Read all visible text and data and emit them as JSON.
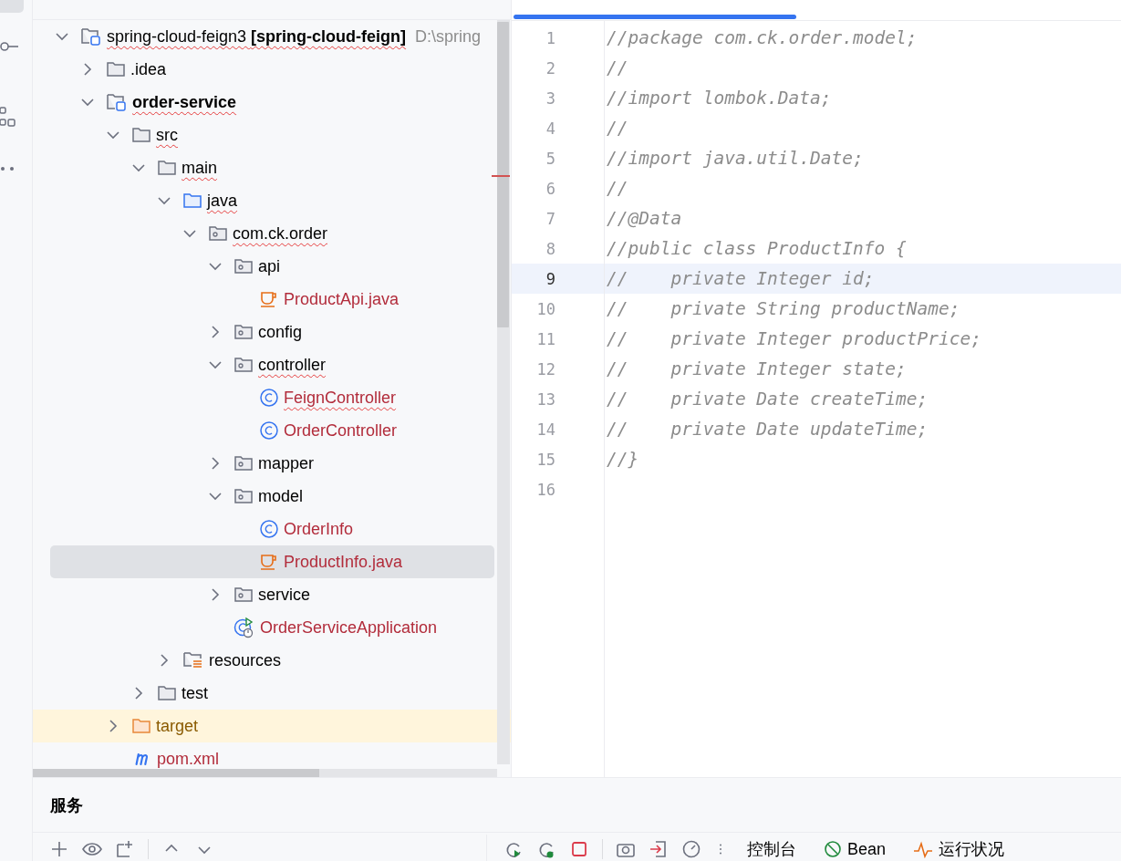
{
  "project_tree": {
    "items": [
      {
        "label": "spring-cloud-feign3 **[spring-cloud-feign]**",
        "path": "D:\\spring",
        "kind": "module",
        "expanded": true,
        "flagged": true,
        "selected": false,
        "children": [
          {
            "label": ".idea",
            "kind": "folder",
            "expanded": false,
            "flagged": false,
            "selected": false
          },
          {
            "label": "order-service",
            "kind": "module",
            "expanded": true,
            "flagged": true,
            "selected": false,
            "children": [
              {
                "label": "src",
                "kind": "folder",
                "expanded": true,
                "flagged": true,
                "selected": false,
                "children": [
                  {
                    "label": "main",
                    "kind": "folder",
                    "expanded": true,
                    "flagged": true,
                    "selected": false,
                    "children": [
                      {
                        "label": "java",
                        "kind": "source",
                        "expanded": true,
                        "flagged": true,
                        "selected": false,
                        "children": [
                          {
                            "label": "com.ck.order",
                            "kind": "package",
                            "expanded": true,
                            "flagged": true,
                            "selected": false,
                            "children": [
                              {
                                "label": "api",
                                "kind": "package",
                                "expanded": true,
                                "flagged": false,
                                "selected": false,
                                "children": [
                                  {
                                    "label": "ProductApi.java",
                                    "kind": "java",
                                    "flagged": false,
                                    "selected": false
                                  }
                                ]
                              },
                              {
                                "label": "config",
                                "kind": "package",
                                "expanded": false,
                                "flagged": false,
                                "selected": false
                              },
                              {
                                "label": "controller",
                                "kind": "package",
                                "expanded": true,
                                "flagged": true,
                                "selected": false,
                                "children": [
                                  {
                                    "label": "FeignController",
                                    "kind": "class",
                                    "flagged": true,
                                    "selected": false
                                  },
                                  {
                                    "label": "OrderController",
                                    "kind": "class",
                                    "flagged": false,
                                    "selected": false
                                  }
                                ]
                              },
                              {
                                "label": "mapper",
                                "kind": "package",
                                "expanded": false,
                                "flagged": false,
                                "selected": false
                              },
                              {
                                "label": "model",
                                "kind": "package",
                                "expanded": true,
                                "flagged": false,
                                "selected": false,
                                "children": [
                                  {
                                    "label": "OrderInfo",
                                    "kind": "class",
                                    "flagged": false,
                                    "selected": false
                                  },
                                  {
                                    "label": "ProductInfo.java",
                                    "kind": "java",
                                    "flagged": false,
                                    "selected": true
                                  }
                                ]
                              },
                              {
                                "label": "service",
                                "kind": "package",
                                "expanded": false,
                                "flagged": false,
                                "selected": false
                              },
                              {
                                "label": "OrderServiceApplication",
                                "kind": "app",
                                "flagged": false,
                                "selected": false
                              }
                            ]
                          }
                        ]
                      },
                      {
                        "label": "resources",
                        "kind": "resources",
                        "expanded": false,
                        "flagged": false,
                        "selected": false
                      }
                    ]
                  },
                  {
                    "label": "test",
                    "kind": "folder",
                    "expanded": false,
                    "flagged": false,
                    "selected": false
                  }
                ]
              },
              {
                "label": "target",
                "kind": "excluded",
                "expanded": false,
                "flagged": false,
                "selected": false
              },
              {
                "label": "pom.xml",
                "kind": "maven",
                "flagged": false,
                "selected": false
              }
            ]
          }
        ]
      }
    ]
  },
  "editor": {
    "lines": [
      {
        "number": "1",
        "code": "//package com.ck.order.model;",
        "current": false
      },
      {
        "number": "2",
        "code": "//",
        "current": false
      },
      {
        "number": "3",
        "code": "//import lombok.Data;",
        "current": false
      },
      {
        "number": "4",
        "code": "//",
        "current": false
      },
      {
        "number": "5",
        "code": "//import java.util.Date;",
        "current": false
      },
      {
        "number": "6",
        "code": "//",
        "current": false
      },
      {
        "number": "7",
        "code": "//@Data",
        "current": false
      },
      {
        "number": "8",
        "code": "//public class ProductInfo {",
        "current": false
      },
      {
        "number": "9",
        "code": "//    private Integer id;",
        "current": true
      },
      {
        "number": "10",
        "code": "//    private String productName;",
        "current": false
      },
      {
        "number": "11",
        "code": "//    private Integer productPrice;",
        "current": false
      },
      {
        "number": "12",
        "code": "//    private Integer state;",
        "current": false
      },
      {
        "number": "13",
        "code": "//    private Date createTime;",
        "current": false
      },
      {
        "number": "14",
        "code": "//    private Date updateTime;",
        "current": false
      },
      {
        "number": "15",
        "code": "//}",
        "current": false
      },
      {
        "number": "16",
        "current": false
      }
    ]
  },
  "services_panel": {
    "title": "服务",
    "tabs": [
      {
        "label": "控制台",
        "kind": "console",
        "selected": false
      },
      {
        "label": "Bean",
        "kind": "bean",
        "selected": false
      },
      {
        "label": "运行状况",
        "kind": "health",
        "selected": false
      }
    ]
  }
}
